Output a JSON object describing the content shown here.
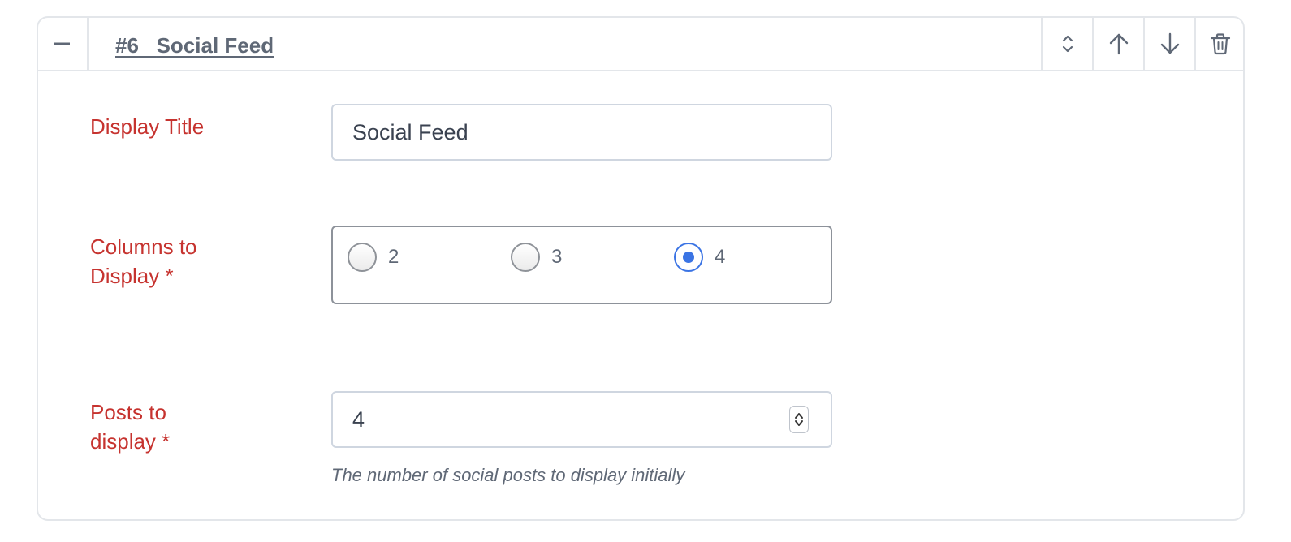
{
  "header": {
    "number": "#6",
    "title": "Social Feed"
  },
  "fields": {
    "display_title": {
      "label": "Display Title",
      "value": "Social Feed"
    },
    "columns": {
      "label_line1": "Columns to",
      "label_line2": "Display *",
      "options": [
        "2",
        "3",
        "4"
      ],
      "selected": "4"
    },
    "posts": {
      "label_line1": "Posts to",
      "label_line2": "display *",
      "value": "4",
      "hint": "The number of social posts to display initially"
    }
  },
  "colors": {
    "label": "#c6332f",
    "accent": "#3b74e4",
    "border": "#e3e6ea"
  },
  "icons": {
    "collapse": "minus-icon",
    "expand_toggle": "chevron-up-down-icon",
    "move_up": "arrow-up-icon",
    "move_down": "arrow-down-icon",
    "delete": "trash-icon"
  }
}
